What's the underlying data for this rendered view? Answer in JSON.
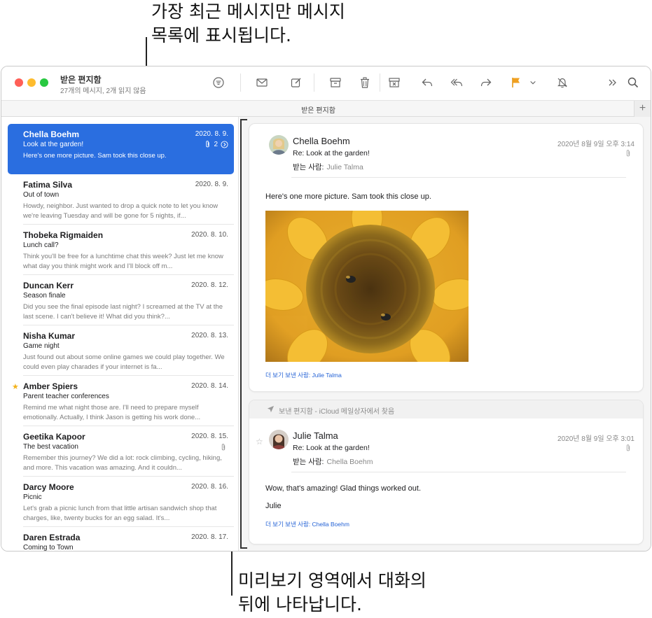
{
  "callouts": {
    "top_line1": "가장 최근 메시지만 메시지",
    "top_line2": "목록에 표시됩니다.",
    "bottom_line1": "미리보기 영역에서 대화의",
    "bottom_line2": "뒤에 나타납니다."
  },
  "window": {
    "title": "받은 편지함",
    "subtitle": "27개의 메시지, 2개 읽지 않음",
    "tab_label": "받은 편지함",
    "tab_plus": "+"
  },
  "toolbar": {
    "icons": [
      "filter-icon",
      "envelope-icon",
      "compose-icon",
      "archive-icon",
      "trash-icon",
      "junk-icon",
      "reply-icon",
      "reply-all-icon",
      "forward-icon",
      "flag-icon",
      "chevron-down-icon",
      "mute-bell-icon",
      "overflow-icon",
      "search-icon"
    ],
    "flag_color": "#f0a020"
  },
  "messages": [
    {
      "sender": "Chella Boehm",
      "date": "2020. 8. 9.",
      "subject": "Look at the garden!",
      "preview": "Here's one more picture. Sam took this close up.",
      "thread_count": "2",
      "selected": true
    },
    {
      "sender": "Fatima Silva",
      "date": "2020. 8. 9.",
      "subject": "Out of town",
      "preview": "Howdy, neighbor. Just wanted to drop a quick note to let you know we're leaving Tuesday and will be gone for 5 nights, if..."
    },
    {
      "sender": "Thobeka Rigmaiden",
      "date": "2020. 8. 10.",
      "subject": "Lunch call?",
      "preview": "Think you'll be free for a lunchtime chat this week? Just let me know what day you think might work and I'll block off m..."
    },
    {
      "sender": "Duncan Kerr",
      "date": "2020. 8. 12.",
      "subject": "Season finale",
      "preview": "Did you see the final episode last night? I screamed at the TV at the last scene. I can't believe it! What did you think?..."
    },
    {
      "sender": "Nisha Kumar",
      "date": "2020. 8. 13.",
      "subject": "Game night",
      "preview": "Just found out about some online games we could play together. We could even play charades if your internet is fa..."
    },
    {
      "sender": "Amber Spiers",
      "date": "2020. 8. 14.",
      "subject": "Parent teacher conferences",
      "preview": "Remind me what night those are. I'll need to prepare myself emotionally. Actually, I think Jason is getting his work done...",
      "starred": true
    },
    {
      "sender": "Geetika Kapoor",
      "date": "2020. 8. 15.",
      "subject": "The best vacation",
      "preview": "Remember this journey? We did a lot: rock climbing, cycling, hiking, and more. This vacation was amazing. And it couldn...",
      "attachment": true
    },
    {
      "sender": "Darcy Moore",
      "date": "2020. 8. 16.",
      "subject": "Picnic",
      "preview": "Let's grab a picnic lunch from that little artisan sandwich shop that charges, like, twenty bucks for an egg salad. It's..."
    },
    {
      "sender": "Daren Estrada",
      "date": "2020. 8. 17.",
      "subject": "Coming to Town",
      "preview": ""
    }
  ],
  "conversation": {
    "msg1": {
      "sender": "Chella Boehm",
      "date": "2020년 8월 9일 오후 3:14",
      "subject": "Re: Look at the garden!",
      "to_label": "받는 사람:",
      "to_name": "Julie Talma",
      "body": "Here's one more picture. Sam took this close up.",
      "more": "더 보기 보낸 사람: Julie Talma"
    },
    "banner": "보낸 편지함 - iCloud 메일상자에서 찾음",
    "msg2": {
      "sender": "Julie Talma",
      "date": "2020년 8월 9일 오후 3:01",
      "subject": "Re: Look at the garden!",
      "to_label": "받는 사람:",
      "to_name": "Chella Boehm",
      "body": "Wow, that's amazing! Glad things worked out.",
      "signature": "Julie",
      "more": "더 보기 보낸 사람: Chella Boehm"
    }
  }
}
